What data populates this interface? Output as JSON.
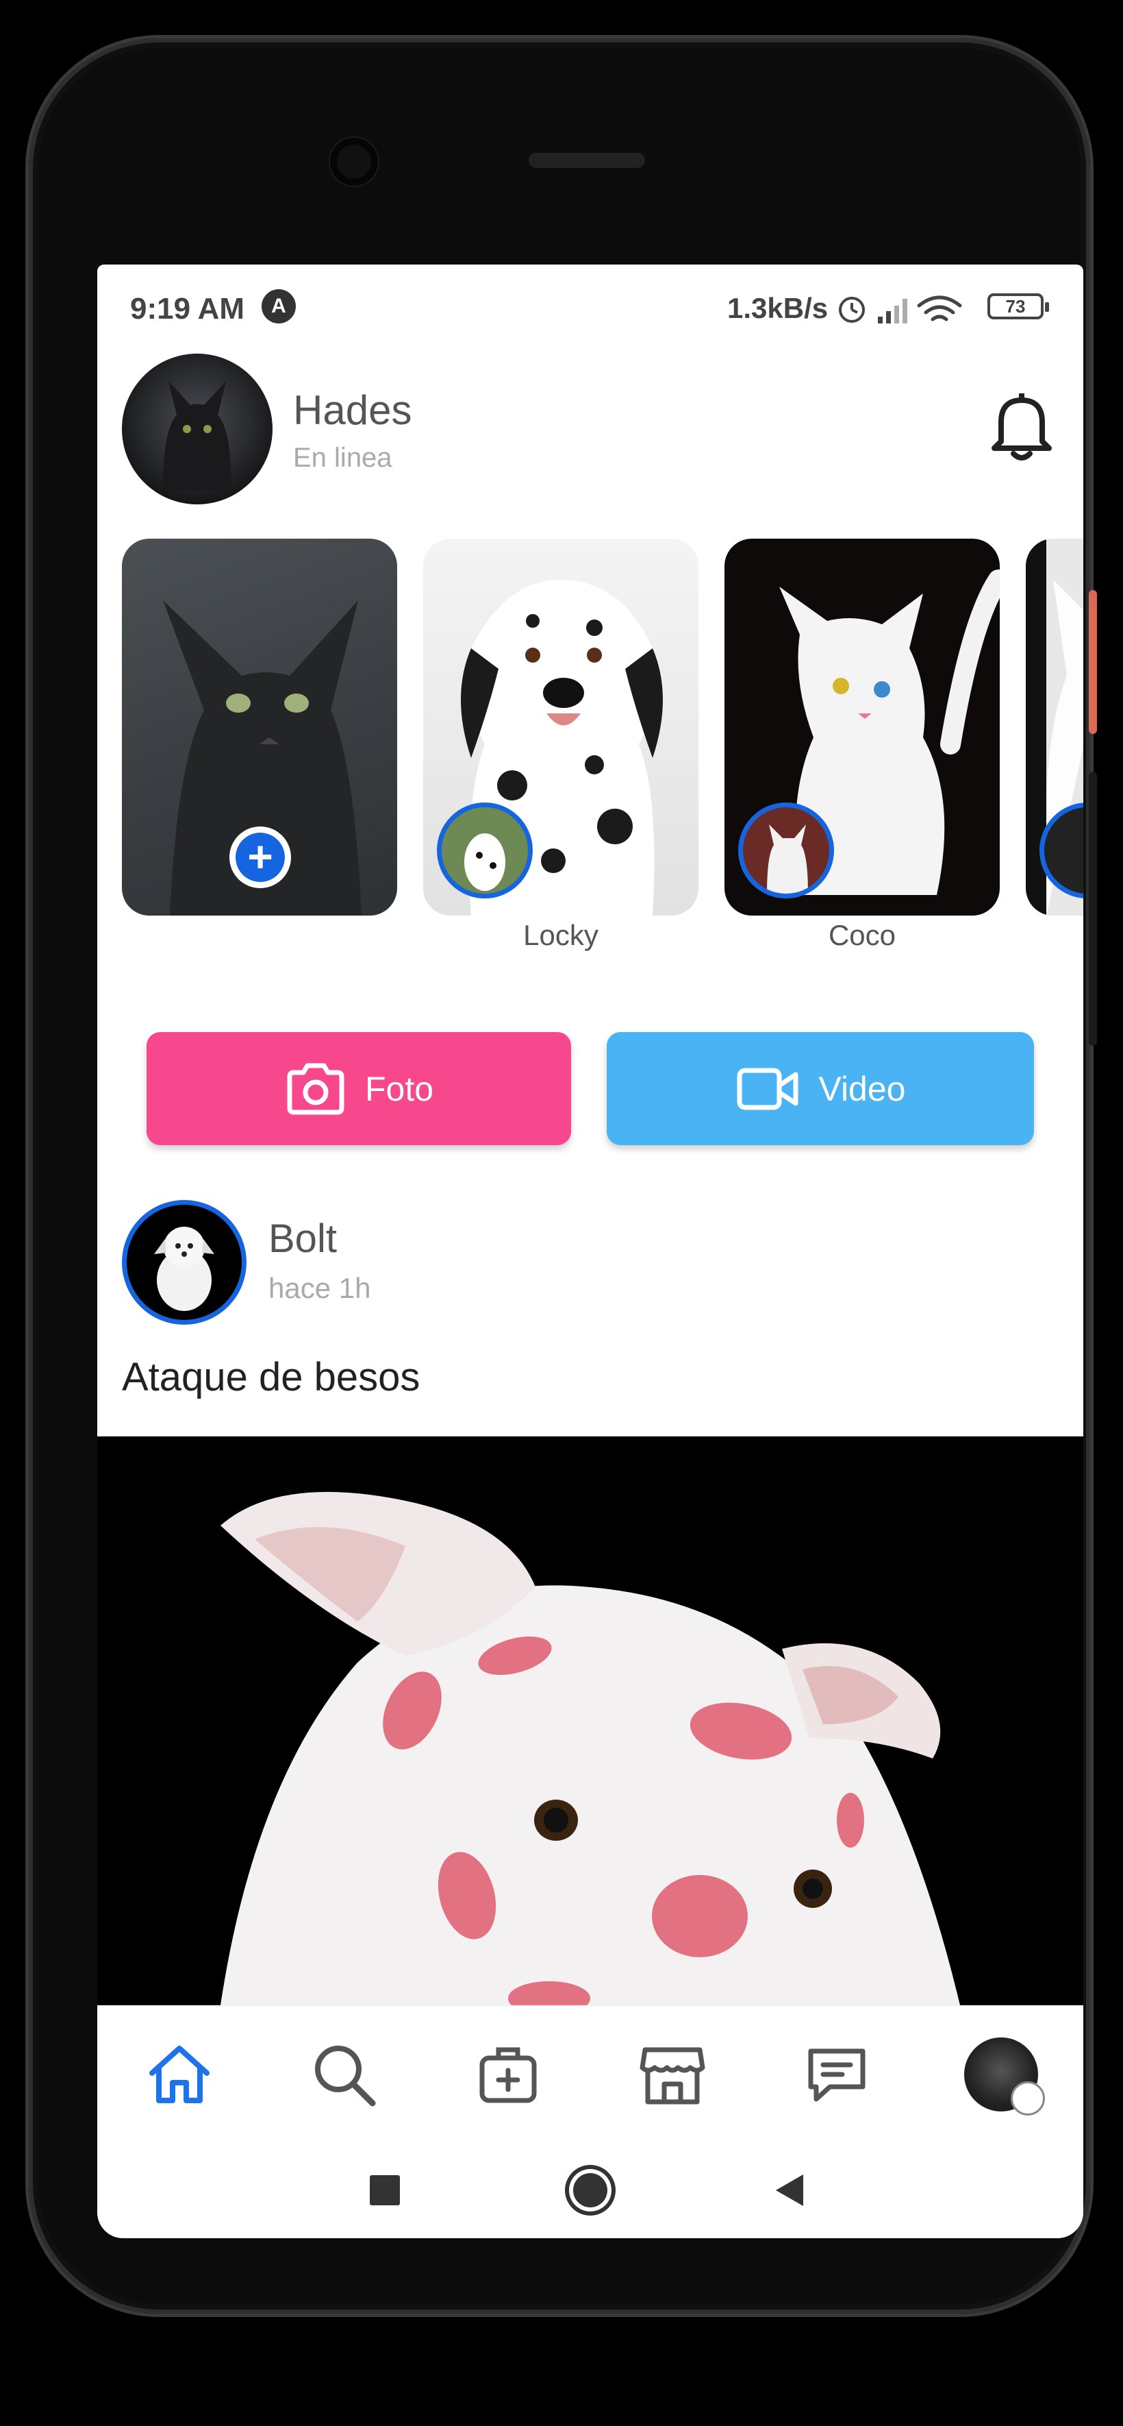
{
  "status_bar": {
    "time": "9:19 AM",
    "app_indicator": "A",
    "network_speed": "1.3kB/s",
    "battery": "73",
    "icons": [
      "alarm-icon",
      "signal-icon",
      "wifi-icon",
      "battery-icon"
    ]
  },
  "profile": {
    "name": "Hades",
    "status": "En linea"
  },
  "stories": [
    {
      "label": "",
      "type": "add"
    },
    {
      "label": "Locky",
      "type": "story"
    },
    {
      "label": "Coco",
      "type": "story"
    },
    {
      "label": "",
      "type": "story"
    }
  ],
  "actions": {
    "foto_label": "Foto",
    "video_label": "Video"
  },
  "post": {
    "author": "Bolt",
    "time": "hace 1h",
    "caption": "Ataque de besos"
  },
  "bottom_nav": [
    "home-icon",
    "search-icon",
    "medical-kit-icon",
    "store-icon",
    "chat-icon",
    "profile-avatar"
  ],
  "colors": {
    "accent_blue": "#1565e0",
    "foto_pink": "#f7478d",
    "video_blue": "#4ab3f4"
  }
}
